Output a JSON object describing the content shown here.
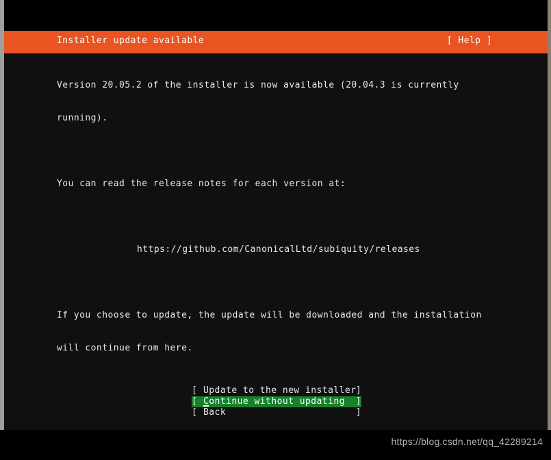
{
  "colors": {
    "header_bg": "#e95420",
    "terminal_bg": "#101010",
    "selection_bg": "#17802a",
    "text_fg": "#e8e8e8",
    "edge_grey": "#9e9e9e"
  },
  "header": {
    "title": "Installer update available",
    "help_label": "[ Help ]"
  },
  "body": {
    "paragraph_1_line_1": "Version 20.05.2 of the installer is now available (20.04.3 is currently",
    "paragraph_1_line_2": "running).",
    "paragraph_2": "You can read the release notes for each version at:",
    "release_notes_url": "https://github.com/CanonicalLtd/subiquity/releases",
    "paragraph_3_line_1": "If you choose to update, the update will be downloaded and the installation",
    "paragraph_3_line_2": "will continue from here.",
    "new_version": "20.05.2",
    "current_version": "20.04.3"
  },
  "buttons": [
    {
      "label": "Update to the new installer",
      "bracket_left": "[",
      "bracket_right": "]",
      "selected": false
    },
    {
      "label": "Continue without updating",
      "bracket_left": "[",
      "bracket_right": "]",
      "selected": true
    },
    {
      "label": "Back",
      "bracket_left": "[",
      "bracket_right": "]",
      "selected": false
    }
  ],
  "watermark": {
    "text": "https://blog.csdn.net/qq_42289214"
  }
}
